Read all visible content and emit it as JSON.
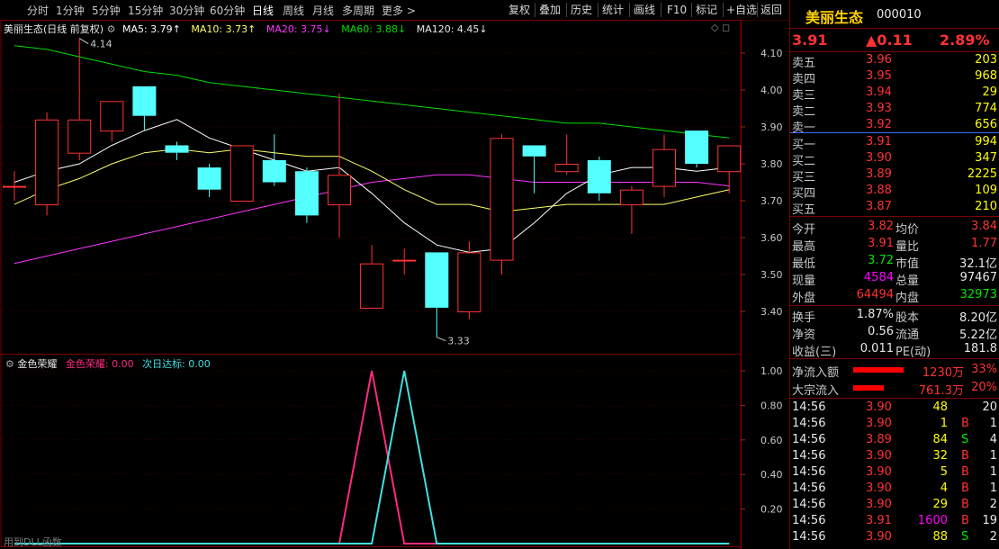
{
  "toolbar": {
    "periods": [
      "分时",
      "1分钟",
      "5分钟",
      "15分钟",
      "30分钟",
      "60分钟",
      "日线",
      "周线",
      "月线",
      "多周期",
      "更多 >"
    ],
    "active_period": "日线",
    "buttons": [
      "复权",
      "叠加",
      "历史",
      "统计",
      "画线",
      "F10",
      "标记",
      "+自选",
      "返回"
    ]
  },
  "main_legend": {
    "title": "美丽生态(日线 前复权)",
    "ma5": "MA5: 3.79↑",
    "ma10": "MA10: 3.73↑",
    "ma20": "MA20: 3.75↓",
    "ma60": "MA60: 3.88↓",
    "ma120": "MA120: 4.45↓"
  },
  "indicator_legend": {
    "name": "金色荣耀",
    "line1": "金色荣耀: 0.00",
    "line2": "次日达标: 0.00"
  },
  "bottom_note": "用到DLL函数",
  "colors": {
    "up": "#ff3232",
    "down": "#54ffff",
    "ma5": "#ffffff",
    "ma10": "#ffff66",
    "ma20": "#ff33ff",
    "ma60": "#00dd00",
    "ind1": "#ff2a7f",
    "ind2": "#40e0e0"
  },
  "chart_data": [
    {
      "type": "candlestick",
      "ylim": [
        3.33,
        4.14
      ],
      "y_ticks": [
        "4.10",
        "4.00",
        "3.90",
        "3.80",
        "3.70",
        "3.60",
        "3.50",
        "3.40"
      ],
      "annotations": {
        "high": "4.14",
        "low": "3.33"
      },
      "candles": [
        {
          "o": 3.74,
          "h": 3.78,
          "l": 3.7,
          "c": 3.74
        },
        {
          "o": 3.69,
          "h": 3.94,
          "l": 3.66,
          "c": 3.92
        },
        {
          "o": 3.83,
          "h": 4.14,
          "l": 3.81,
          "c": 3.92
        },
        {
          "o": 3.89,
          "h": 3.94,
          "l": 3.86,
          "c": 3.97
        },
        {
          "o": 4.01,
          "h": 4.01,
          "l": 3.89,
          "c": 3.93
        },
        {
          "o": 3.85,
          "h": 3.86,
          "l": 3.81,
          "c": 3.83
        },
        {
          "o": 3.79,
          "h": 3.8,
          "l": 3.71,
          "c": 3.73
        },
        {
          "o": 3.7,
          "h": 3.85,
          "l": 3.7,
          "c": 3.85
        },
        {
          "o": 3.81,
          "h": 3.88,
          "l": 3.74,
          "c": 3.75
        },
        {
          "o": 3.78,
          "h": 3.79,
          "l": 3.64,
          "c": 3.66
        },
        {
          "o": 3.69,
          "h": 3.99,
          "l": 3.6,
          "c": 3.77
        },
        {
          "o": 3.41,
          "h": 3.58,
          "l": 3.41,
          "c": 3.53
        },
        {
          "o": 3.54,
          "h": 3.57,
          "l": 3.5,
          "c": 3.54
        },
        {
          "o": 3.56,
          "h": 3.56,
          "l": 3.33,
          "c": 3.41
        },
        {
          "o": 3.4,
          "h": 3.59,
          "l": 3.38,
          "c": 3.56
        },
        {
          "o": 3.54,
          "h": 3.88,
          "l": 3.5,
          "c": 3.87
        },
        {
          "o": 3.85,
          "h": 3.85,
          "l": 3.72,
          "c": 3.82
        },
        {
          "o": 3.78,
          "h": 3.88,
          "l": 3.77,
          "c": 3.8
        },
        {
          "o": 3.81,
          "h": 3.82,
          "l": 3.7,
          "c": 3.72
        },
        {
          "o": 3.69,
          "h": 3.74,
          "l": 3.61,
          "c": 3.73
        },
        {
          "o": 3.74,
          "h": 3.88,
          "l": 3.71,
          "c": 3.84
        },
        {
          "o": 3.89,
          "h": 3.89,
          "l": 3.79,
          "c": 3.8
        },
        {
          "o": 3.78,
          "h": 3.85,
          "l": 3.72,
          "c": 3.85
        }
      ],
      "ma5": [
        3.75,
        3.78,
        3.8,
        3.85,
        3.89,
        3.92,
        3.87,
        3.84,
        3.81,
        3.78,
        3.79,
        3.72,
        3.64,
        3.58,
        3.56,
        3.57,
        3.64,
        3.72,
        3.77,
        3.79,
        3.79,
        3.78,
        3.79
      ],
      "ma10": [
        3.69,
        3.73,
        3.76,
        3.8,
        3.83,
        3.84,
        3.83,
        3.84,
        3.83,
        3.82,
        3.82,
        3.78,
        3.73,
        3.69,
        3.69,
        3.67,
        3.68,
        3.69,
        3.69,
        3.69,
        3.69,
        3.71,
        3.73
      ],
      "ma20": [
        3.53,
        3.55,
        3.57,
        3.59,
        3.61,
        3.63,
        3.65,
        3.67,
        3.69,
        3.71,
        3.73,
        3.75,
        3.76,
        3.77,
        3.77,
        3.76,
        3.75,
        3.75,
        3.75,
        3.75,
        3.75,
        3.75,
        3.74
      ],
      "ma60": [
        4.12,
        4.11,
        4.09,
        4.07,
        4.05,
        4.04,
        4.02,
        4.01,
        4.0,
        3.99,
        3.98,
        3.97,
        3.96,
        3.95,
        3.94,
        3.93,
        3.92,
        3.91,
        3.91,
        3.9,
        3.89,
        3.88,
        3.87
      ]
    },
    {
      "type": "line",
      "ylim": [
        0,
        1.0
      ],
      "y_ticks": [
        "1.00",
        "0.80",
        "0.60",
        "0.40",
        "0.20"
      ],
      "series": [
        {
          "name": "金色荣耀",
          "values": [
            0,
            0,
            0,
            0,
            0,
            0,
            0,
            0,
            0,
            0,
            0,
            1,
            0,
            0,
            0,
            0,
            0,
            0,
            0,
            0,
            0,
            0,
            0
          ]
        },
        {
          "name": "次日达标",
          "values": [
            0,
            0,
            0,
            0,
            0,
            0,
            0,
            0,
            0,
            0,
            0,
            0,
            1,
            0,
            0,
            0,
            0,
            0,
            0,
            0,
            0,
            0,
            0
          ]
        }
      ]
    }
  ],
  "panel": {
    "name": "美丽生态",
    "code": "000010",
    "price": "3.91",
    "change": "▲0.11",
    "pct": "2.89%",
    "asks": [
      {
        "label": "卖五",
        "price": "3.96",
        "vol": "203"
      },
      {
        "label": "卖四",
        "price": "3.95",
        "vol": "968"
      },
      {
        "label": "卖三",
        "price": "3.94",
        "vol": "29"
      },
      {
        "label": "卖二",
        "price": "3.93",
        "vol": "774"
      },
      {
        "label": "卖一",
        "price": "3.92",
        "vol": "656"
      }
    ],
    "bids": [
      {
        "label": "买一",
        "price": "3.91",
        "vol": "994"
      },
      {
        "label": "买二",
        "price": "3.90",
        "vol": "347"
      },
      {
        "label": "买三",
        "price": "3.89",
        "vol": "2225"
      },
      {
        "label": "买四",
        "price": "3.88",
        "vol": "109"
      },
      {
        "label": "买五",
        "price": "3.87",
        "vol": "210"
      }
    ],
    "stats": [
      {
        "l1": "今开",
        "v1": "3.82",
        "c1": "red",
        "l2": "均价",
        "v2": "3.84",
        "c2": "red"
      },
      {
        "l1": "最高",
        "v1": "3.91",
        "c1": "red",
        "l2": "量比",
        "v2": "1.77",
        "c2": "red"
      },
      {
        "l1": "最低",
        "v1": "3.72",
        "c1": "green",
        "l2": "市值",
        "v2": "32.1亿",
        "c2": "white"
      },
      {
        "l1": "现量",
        "v1": "4584",
        "c1": "magenta",
        "l2": "总量",
        "v2": "97467",
        "c2": "white"
      },
      {
        "l1": "外盘",
        "v1": "64494",
        "c1": "red",
        "l2": "内盘",
        "v2": "32973",
        "c2": "green"
      }
    ],
    "fund": [
      {
        "l1": "换手",
        "v1": "1.87%",
        "l2": "股本",
        "v2": "8.20亿"
      },
      {
        "l1": "净资",
        "v1": "0.56",
        "l2": "流通",
        "v2": "5.22亿"
      },
      {
        "l1": "收益(三)",
        "v1": "0.011",
        "l2": "PE(动)",
        "v2": "181.8"
      }
    ],
    "flows": [
      {
        "label": "净流入额",
        "value": "1230万",
        "pct": "33%",
        "bar": 0.33
      },
      {
        "label": "大宗流入",
        "value": "761.3万",
        "pct": "20%",
        "bar": 0.2
      }
    ],
    "ticks": [
      {
        "t": "14:56",
        "p": "3.90",
        "v": "48",
        "d": "",
        "n": "20",
        "vc": "yellow"
      },
      {
        "t": "14:56",
        "p": "3.90",
        "v": "1",
        "d": "B",
        "n": "1",
        "vc": "yellow"
      },
      {
        "t": "14:56",
        "p": "3.89",
        "v": "84",
        "d": "S",
        "n": "4",
        "vc": "yellow"
      },
      {
        "t": "14:56",
        "p": "3.90",
        "v": "32",
        "d": "B",
        "n": "1",
        "vc": "yellow"
      },
      {
        "t": "14:56",
        "p": "3.90",
        "v": "5",
        "d": "B",
        "n": "1",
        "vc": "yellow"
      },
      {
        "t": "14:56",
        "p": "3.90",
        "v": "4",
        "d": "B",
        "n": "1",
        "vc": "yellow"
      },
      {
        "t": "14:56",
        "p": "3.90",
        "v": "29",
        "d": "B",
        "n": "2",
        "vc": "yellow"
      },
      {
        "t": "14:56",
        "p": "3.91",
        "v": "1600",
        "d": "B",
        "n": "19",
        "vc": "magenta"
      },
      {
        "t": "14:56",
        "p": "3.90",
        "v": "88",
        "d": "S",
        "n": "2",
        "vc": "yellow"
      }
    ]
  }
}
